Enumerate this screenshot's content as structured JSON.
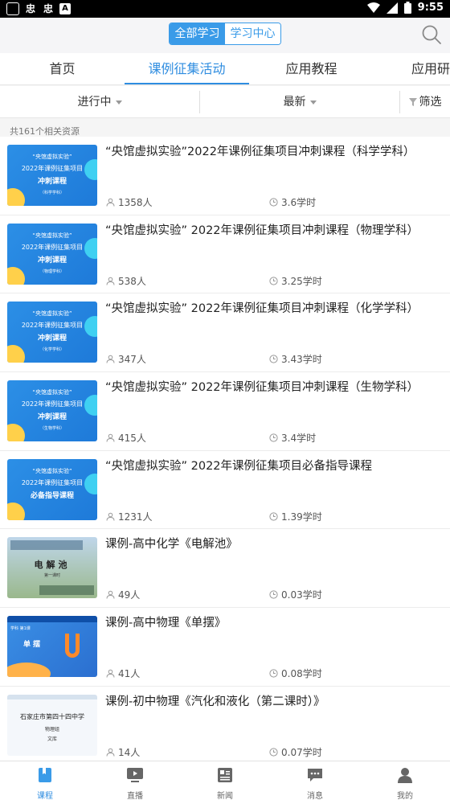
{
  "status_bar": {
    "time": "9:55",
    "left_glyph_1": "忠",
    "left_glyph_2": "忠",
    "left_glyph_3": "A"
  },
  "header": {
    "segments": [
      "全部学习",
      "学习中心"
    ],
    "active_segment": "全部学习",
    "accent_color": "#3a9be8"
  },
  "tabs": [
    "首页",
    "课例征集活动",
    "应用教程",
    "应用研"
  ],
  "active_tab": "课例征集活动",
  "filters": {
    "status": "进行中",
    "sort": "最新",
    "filter": "筛选"
  },
  "result_count": "共161个相关资源",
  "items": [
    {
      "title": "“央馆虚拟实验”2022年课例征集项目冲刺课程（科学学科）",
      "learners": "1358人",
      "hours": "3.6学时",
      "thumb": {
        "line1": "“央馆虚拟实验”",
        "line2": "2022年课例征集项目",
        "line3": "冲刺课程",
        "line4": "（科学学科）"
      }
    },
    {
      "title": "“央馆虚拟实验” 2022年课例征集项目冲刺课程（物理学科）",
      "learners": "538人",
      "hours": "3.25学时",
      "thumb": {
        "line1": "“央馆虚拟实验”",
        "line2": "2022年课例征集项目",
        "line3": "冲刺课程",
        "line4": "（物理学科）"
      }
    },
    {
      "title": "“央馆虚拟实验” 2022年课例征集项目冲刺课程（化学学科）",
      "learners": "347人",
      "hours": "3.43学时",
      "thumb": {
        "line1": "“央馆虚拟实验”",
        "line2": "2022年课例征集项目",
        "line3": "冲刺课程",
        "line4": "（化学学科）"
      }
    },
    {
      "title": "“央馆虚拟实验” 2022年课例征集项目冲刺课程（生物学科）",
      "learners": "415人",
      "hours": "3.4学时",
      "thumb": {
        "line1": "“央馆虚拟实验”",
        "line2": "2022年课例征集项目",
        "line3": "冲刺课程",
        "line4": "（生物学科）"
      }
    },
    {
      "title": "“央馆虚拟实验” 2022年课例征集项目必备指导课程",
      "learners": "1231人",
      "hours": "1.39学时",
      "thumb": {
        "line1": "“央馆虚拟实验”",
        "line2": "2022年课例征集项目",
        "line3": "必备指导课程",
        "line4": ""
      }
    },
    {
      "title": "课例-高中化学《电解池》",
      "learners": "49人",
      "hours": "0.03学时",
      "thumb": {
        "line1": "电解池",
        "line2": "第一课时"
      }
    },
    {
      "title": "课例-高中物理《单摆》",
      "learners": "41人",
      "hours": "0.08学时",
      "thumb": {
        "line1": "单摆",
        "line2": "学科 第1课"
      }
    },
    {
      "title": "课例-初中物理《汽化和液化（第二课时）》",
      "learners": "14人",
      "hours": "0.07学时",
      "thumb": {
        "line1": "石家庄市第四十四中学",
        "line2": "物理组",
        "line3": "文库"
      }
    }
  ],
  "bottom_nav": [
    {
      "label": "课程",
      "icon": "book-icon",
      "active": true
    },
    {
      "label": "直播",
      "icon": "live-tv-icon",
      "active": false
    },
    {
      "label": "新闻",
      "icon": "newspaper-icon",
      "active": false
    },
    {
      "label": "消息",
      "icon": "chat-bubble-icon",
      "active": false
    },
    {
      "label": "我的",
      "icon": "person-icon",
      "active": false
    }
  ],
  "colors": {
    "primary": "#2f8de0",
    "thumb_blue": "#1e7ad9",
    "divider": "#ececec"
  }
}
